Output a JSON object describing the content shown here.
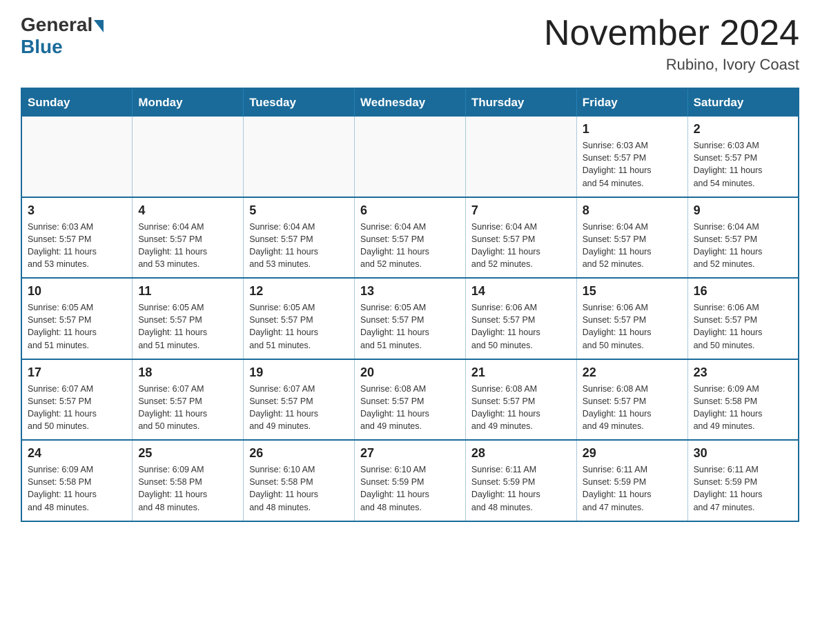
{
  "header": {
    "logo_general": "General",
    "logo_blue": "Blue",
    "month_year": "November 2024",
    "location": "Rubino, Ivory Coast"
  },
  "weekdays": [
    "Sunday",
    "Monday",
    "Tuesday",
    "Wednesday",
    "Thursday",
    "Friday",
    "Saturday"
  ],
  "weeks": [
    [
      {
        "day": "",
        "info": ""
      },
      {
        "day": "",
        "info": ""
      },
      {
        "day": "",
        "info": ""
      },
      {
        "day": "",
        "info": ""
      },
      {
        "day": "",
        "info": ""
      },
      {
        "day": "1",
        "info": "Sunrise: 6:03 AM\nSunset: 5:57 PM\nDaylight: 11 hours\nand 54 minutes."
      },
      {
        "day": "2",
        "info": "Sunrise: 6:03 AM\nSunset: 5:57 PM\nDaylight: 11 hours\nand 54 minutes."
      }
    ],
    [
      {
        "day": "3",
        "info": "Sunrise: 6:03 AM\nSunset: 5:57 PM\nDaylight: 11 hours\nand 53 minutes."
      },
      {
        "day": "4",
        "info": "Sunrise: 6:04 AM\nSunset: 5:57 PM\nDaylight: 11 hours\nand 53 minutes."
      },
      {
        "day": "5",
        "info": "Sunrise: 6:04 AM\nSunset: 5:57 PM\nDaylight: 11 hours\nand 53 minutes."
      },
      {
        "day": "6",
        "info": "Sunrise: 6:04 AM\nSunset: 5:57 PM\nDaylight: 11 hours\nand 52 minutes."
      },
      {
        "day": "7",
        "info": "Sunrise: 6:04 AM\nSunset: 5:57 PM\nDaylight: 11 hours\nand 52 minutes."
      },
      {
        "day": "8",
        "info": "Sunrise: 6:04 AM\nSunset: 5:57 PM\nDaylight: 11 hours\nand 52 minutes."
      },
      {
        "day": "9",
        "info": "Sunrise: 6:04 AM\nSunset: 5:57 PM\nDaylight: 11 hours\nand 52 minutes."
      }
    ],
    [
      {
        "day": "10",
        "info": "Sunrise: 6:05 AM\nSunset: 5:57 PM\nDaylight: 11 hours\nand 51 minutes."
      },
      {
        "day": "11",
        "info": "Sunrise: 6:05 AM\nSunset: 5:57 PM\nDaylight: 11 hours\nand 51 minutes."
      },
      {
        "day": "12",
        "info": "Sunrise: 6:05 AM\nSunset: 5:57 PM\nDaylight: 11 hours\nand 51 minutes."
      },
      {
        "day": "13",
        "info": "Sunrise: 6:05 AM\nSunset: 5:57 PM\nDaylight: 11 hours\nand 51 minutes."
      },
      {
        "day": "14",
        "info": "Sunrise: 6:06 AM\nSunset: 5:57 PM\nDaylight: 11 hours\nand 50 minutes."
      },
      {
        "day": "15",
        "info": "Sunrise: 6:06 AM\nSunset: 5:57 PM\nDaylight: 11 hours\nand 50 minutes."
      },
      {
        "day": "16",
        "info": "Sunrise: 6:06 AM\nSunset: 5:57 PM\nDaylight: 11 hours\nand 50 minutes."
      }
    ],
    [
      {
        "day": "17",
        "info": "Sunrise: 6:07 AM\nSunset: 5:57 PM\nDaylight: 11 hours\nand 50 minutes."
      },
      {
        "day": "18",
        "info": "Sunrise: 6:07 AM\nSunset: 5:57 PM\nDaylight: 11 hours\nand 50 minutes."
      },
      {
        "day": "19",
        "info": "Sunrise: 6:07 AM\nSunset: 5:57 PM\nDaylight: 11 hours\nand 49 minutes."
      },
      {
        "day": "20",
        "info": "Sunrise: 6:08 AM\nSunset: 5:57 PM\nDaylight: 11 hours\nand 49 minutes."
      },
      {
        "day": "21",
        "info": "Sunrise: 6:08 AM\nSunset: 5:57 PM\nDaylight: 11 hours\nand 49 minutes."
      },
      {
        "day": "22",
        "info": "Sunrise: 6:08 AM\nSunset: 5:57 PM\nDaylight: 11 hours\nand 49 minutes."
      },
      {
        "day": "23",
        "info": "Sunrise: 6:09 AM\nSunset: 5:58 PM\nDaylight: 11 hours\nand 49 minutes."
      }
    ],
    [
      {
        "day": "24",
        "info": "Sunrise: 6:09 AM\nSunset: 5:58 PM\nDaylight: 11 hours\nand 48 minutes."
      },
      {
        "day": "25",
        "info": "Sunrise: 6:09 AM\nSunset: 5:58 PM\nDaylight: 11 hours\nand 48 minutes."
      },
      {
        "day": "26",
        "info": "Sunrise: 6:10 AM\nSunset: 5:58 PM\nDaylight: 11 hours\nand 48 minutes."
      },
      {
        "day": "27",
        "info": "Sunrise: 6:10 AM\nSunset: 5:59 PM\nDaylight: 11 hours\nand 48 minutes."
      },
      {
        "day": "28",
        "info": "Sunrise: 6:11 AM\nSunset: 5:59 PM\nDaylight: 11 hours\nand 48 minutes."
      },
      {
        "day": "29",
        "info": "Sunrise: 6:11 AM\nSunset: 5:59 PM\nDaylight: 11 hours\nand 47 minutes."
      },
      {
        "day": "30",
        "info": "Sunrise: 6:11 AM\nSunset: 5:59 PM\nDaylight: 11 hours\nand 47 minutes."
      }
    ]
  ]
}
